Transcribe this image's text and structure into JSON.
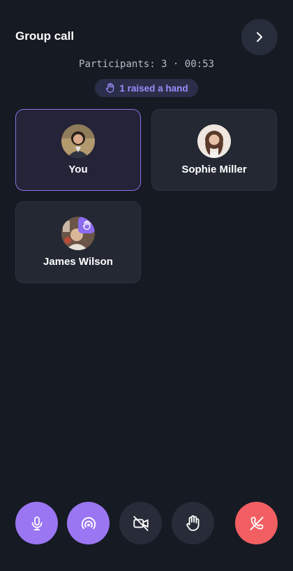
{
  "header": {
    "title": "Group call",
    "next_icon": "chevron-right-icon"
  },
  "call": {
    "participants_label": "Participants",
    "participants_count": "3",
    "separator": "·",
    "elapsed": "00:53",
    "raised_hands_text": "1 raised a hand"
  },
  "participants": [
    {
      "name": "You",
      "is_self": true,
      "hand_raised": false
    },
    {
      "name": "Sophie Miller",
      "is_self": false,
      "hand_raised": false
    },
    {
      "name": "James Wilson",
      "is_self": false,
      "hand_raised": true
    }
  ],
  "controls": [
    {
      "name": "microphone",
      "icon": "microphone-icon",
      "state": "on"
    },
    {
      "name": "broadcast",
      "icon": "broadcast-icon",
      "state": "on"
    },
    {
      "name": "camera",
      "icon": "camera-off-icon",
      "state": "off"
    },
    {
      "name": "raise-hand",
      "icon": "hand-icon",
      "state": "off"
    },
    {
      "name": "end-call",
      "icon": "phone-hangup-icon",
      "state": "danger"
    }
  ],
  "colors": {
    "background": "#161a23",
    "accent": "#9a76f3",
    "danger": "#f25f62",
    "tile": "#232833"
  }
}
